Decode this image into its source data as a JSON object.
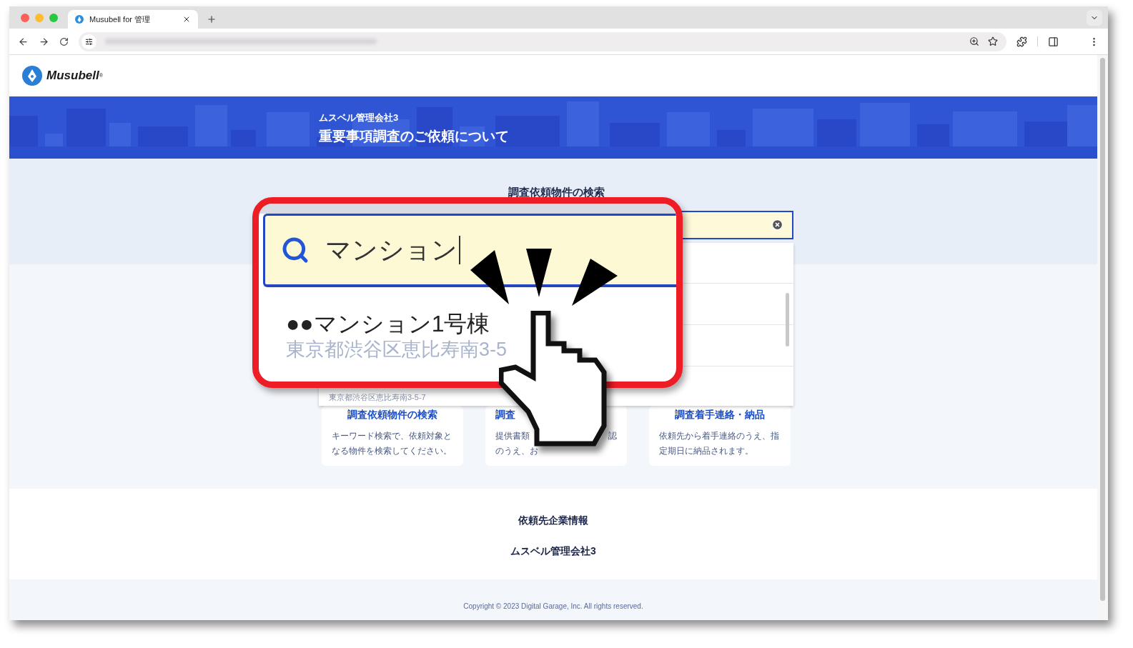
{
  "browser": {
    "tab": {
      "title": "Musubell for 管理",
      "selected": true
    }
  },
  "header": {
    "logo": {
      "text": "Musubell",
      "mark": "®"
    }
  },
  "banner": {
    "company": "ムスベル管理会社3",
    "title": "重要事項調査のご依頼について"
  },
  "search": {
    "heading": "調査依頼物件の検索",
    "results": [
      {
        "address": "東京都渋谷区恵比寿南3-5-7"
      }
    ]
  },
  "steps": [
    {
      "title": "調査依頼物件の検索",
      "lines": [
        [
          "キーワード検索で、依頼対象と"
        ],
        [
          "なる物件を検索してください。"
        ]
      ]
    },
    {
      "title": "調査",
      "kind": "cut",
      "lines": [
        [
          "提供書類",
          "認"
        ],
        [
          "のうえ、お"
        ]
      ]
    },
    {
      "title": "調査着手連絡・納品",
      "lines": [
        [
          "依頼先から着手連絡のうえ、指"
        ],
        [
          "定期日に納品されます。"
        ]
      ]
    }
  ],
  "contractor": {
    "heading": "依頼先企業情報",
    "name": "ムスベル管理会社3"
  },
  "footer": {
    "copyright": "Copyright © 2023 Digital Garage, Inc. All rights reserved."
  },
  "callout": {
    "query": "マンション",
    "result": {
      "name": "●●マンション1号棟",
      "address": "東京都渋谷区恵比寿南3-5"
    }
  }
}
